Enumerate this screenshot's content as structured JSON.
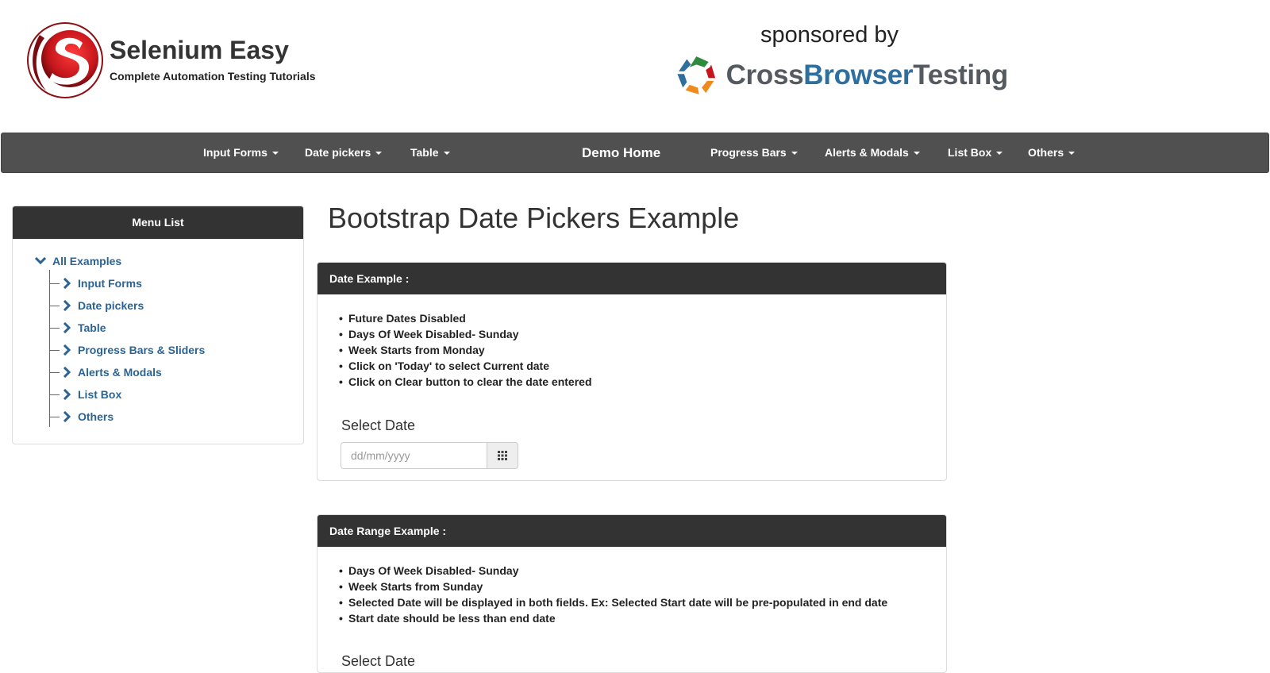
{
  "header": {
    "brand_title": "Selenium Easy",
    "brand_subtitle": "Complete Automation Testing Tutorials",
    "sponsor_label": "sponsored by",
    "sponsor_name_part1": "Cross",
    "sponsor_name_part2": "Browser",
    "sponsor_name_part3": "Testing"
  },
  "navbar": {
    "items": [
      {
        "label": "Input Forms",
        "dropdown": true
      },
      {
        "label": "Date pickers",
        "dropdown": true
      },
      {
        "label": "Table",
        "dropdown": true
      },
      {
        "label": "Demo Home",
        "dropdown": false
      },
      {
        "label": "Progress Bars",
        "dropdown": true
      },
      {
        "label": "Alerts & Modals",
        "dropdown": true
      },
      {
        "label": "List Box",
        "dropdown": true
      },
      {
        "label": "Others",
        "dropdown": true
      }
    ]
  },
  "sidebar": {
    "title": "Menu List",
    "root": "All Examples",
    "items": [
      {
        "label": "Input Forms"
      },
      {
        "label": "Date pickers"
      },
      {
        "label": "Table"
      },
      {
        "label": "Progress Bars & Sliders"
      },
      {
        "label": "Alerts & Modals"
      },
      {
        "label": "List Box"
      },
      {
        "label": "Others"
      }
    ]
  },
  "main": {
    "title": "Bootstrap Date Pickers Example",
    "date_example": {
      "heading": "Date Example :",
      "bullets": [
        "Future Dates Disabled",
        "Days Of Week Disabled- Sunday",
        "Week Starts from Monday",
        "Click on 'Today' to select Current date",
        "Click on Clear button to clear the date entered"
      ],
      "field_label": "Select Date",
      "input_value": "",
      "input_placeholder": "dd/mm/yyyy"
    },
    "date_range_example": {
      "heading": "Date Range Example :",
      "bullets": [
        "Days Of Week Disabled- Sunday",
        "Week Starts from Sunday",
        "Selected Date will be displayed in both fields. Ex: Selected Start date will be pre-populated in end date",
        "Start date should be less than end date"
      ],
      "field_label": "Select Date"
    }
  },
  "icons": {
    "calendar_addon": "grid-calendar-icon",
    "tree_expand": "chevron-down-icon",
    "tree_item": "chevron-right-icon"
  },
  "colors": {
    "navbar_bg": "#505050",
    "panel_head_bg": "#333333",
    "link_blue": "#2a6496",
    "logo_red": "#c4161c"
  }
}
